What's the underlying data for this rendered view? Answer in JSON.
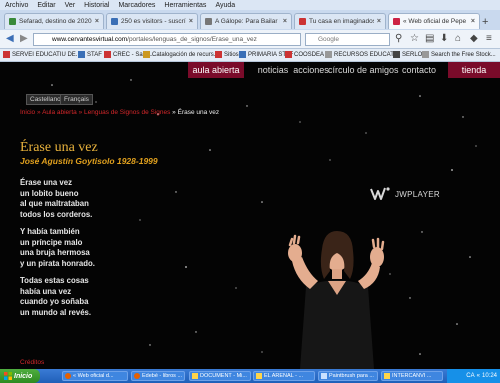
{
  "menubar": [
    "Archivo",
    "Editar",
    "Ver",
    "Historial",
    "Marcadores",
    "Herramientas",
    "Ayuda"
  ],
  "tabs": [
    {
      "title": "Sefarad, destino de 2020...",
      "color": "#3a8a3a"
    },
    {
      "title": "250 es visitors - suscríbete",
      "color": "#3b6fb6"
    },
    {
      "title": "A Gálope: Para Bailar I...",
      "color": "#777777"
    },
    {
      "title": "Tu casa en imaginados, Antonio...",
      "color": "#cc3333"
    },
    {
      "title": "« Web oficial de Pepe Bucle...",
      "color": "#cc2244"
    }
  ],
  "nav": {
    "url_domain": "www.cervantesvirtual.com",
    "url_path": "/portales/lenguas_de_signos/Erase_una_vez",
    "search_placeholder": "Google"
  },
  "bookmarks": [
    {
      "label": "SERVEI EDUCATIU DE...",
      "color": "#cc3333"
    },
    {
      "label": "STAF",
      "color": "#3a6fb6"
    },
    {
      "label": "CREC - Sant...",
      "color": "#cc3333"
    },
    {
      "label": "Catalogación de recurs...",
      "color": "#cc9922"
    },
    {
      "label": "Sitios",
      "color": "#cc3333"
    },
    {
      "label": "PRIMARIA STAF",
      "color": "#3a6fb6"
    },
    {
      "label": "COOSDEA",
      "color": "#cc3333"
    },
    {
      "label": "RECURSOS EDUCATI...",
      "color": "#999999"
    },
    {
      "label": "SERLOC",
      "color": "#444444"
    },
    {
      "label": "Search the Free Stock...",
      "color": "#999999"
    }
  ],
  "site_nav": [
    "aula abierta",
    "noticias",
    "acciones",
    "círculo de amigos",
    "contacto",
    "tienda"
  ],
  "lang_buttons": [
    "Castellano",
    "Français"
  ],
  "breadcrumb": {
    "links": [
      "Inicio",
      "Aula abierta",
      "Lenguas de Signos de Signes"
    ],
    "current": "Érase una vez"
  },
  "page": {
    "title": "Érase una vez",
    "author": "José Agustín Goytisolo 1928-1999"
  },
  "poem": [
    [
      "Érase una vez",
      "un lobito bueno",
      "al que maltrataban",
      "todos los corderos."
    ],
    [
      "Y había también",
      "un príncipe malo",
      "una bruja hermosa",
      "y un pirata honrado."
    ],
    [
      "Todas estas cosas",
      "había una vez",
      "cuando yo soñaba",
      "un mundo al revés."
    ]
  ],
  "bottom_text": "Créditos",
  "video": {
    "brand": "JWPLAYER"
  },
  "taskbar": {
    "start_label": "Inicio",
    "buttons": [
      "« Web oficial d...",
      "Edebé - libros ...",
      "DOCUMENT - Mi...",
      "EL ARENAL - ...",
      "Paintbrush para ...",
      "INTERCANVI ..."
    ],
    "tray": [
      "CA",
      "«",
      "10:24"
    ]
  }
}
